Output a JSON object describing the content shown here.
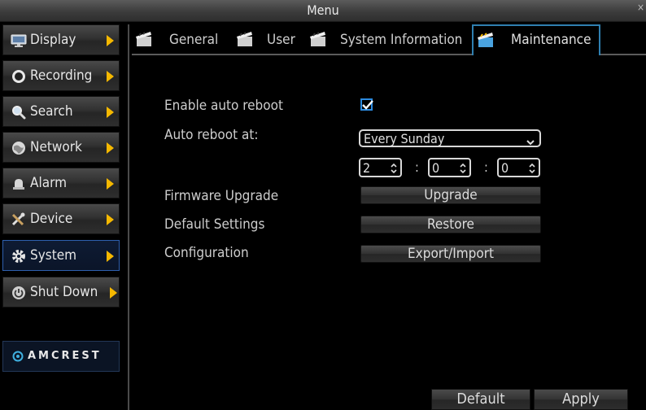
{
  "window": {
    "title": "Menu",
    "close": "×"
  },
  "sidebar": {
    "items": [
      {
        "label": "Display",
        "icon": "monitor-icon"
      },
      {
        "label": "Recording",
        "icon": "record-icon"
      },
      {
        "label": "Search",
        "icon": "search-icon"
      },
      {
        "label": "Network",
        "icon": "globe-icon"
      },
      {
        "label": "Alarm",
        "icon": "alarm-bell-icon"
      },
      {
        "label": "Device",
        "icon": "tools-icon"
      },
      {
        "label": "System",
        "icon": "gear-icon",
        "active": true
      },
      {
        "label": "Shut Down",
        "icon": "power-icon"
      }
    ],
    "logo": "AMCREST",
    "active_color": "#2e5fae",
    "arrow_color": "#f5b800"
  },
  "tabs": [
    {
      "label": "General"
    },
    {
      "label": "User"
    },
    {
      "label": "System Information"
    },
    {
      "label": "Maintenance",
      "active": true
    }
  ],
  "maintenance": {
    "auto_reboot_label": "Enable auto reboot",
    "auto_reboot_checked": true,
    "reboot_at_label": "Auto reboot at:",
    "reboot_day": "Every Sunday",
    "hour": "2",
    "minute": "0",
    "second": "0",
    "separator": ":",
    "firmware_label": "Firmware Upgrade",
    "firmware_button": "Upgrade",
    "default_label": "Default Settings",
    "default_button": "Restore",
    "config_label": "Configuration",
    "config_button": "Export/Import"
  },
  "footer": {
    "default_button": "Default",
    "apply_button": "Apply"
  },
  "colors": {
    "accent": "#2f7fb0",
    "checkbox": "#2c8be0"
  }
}
